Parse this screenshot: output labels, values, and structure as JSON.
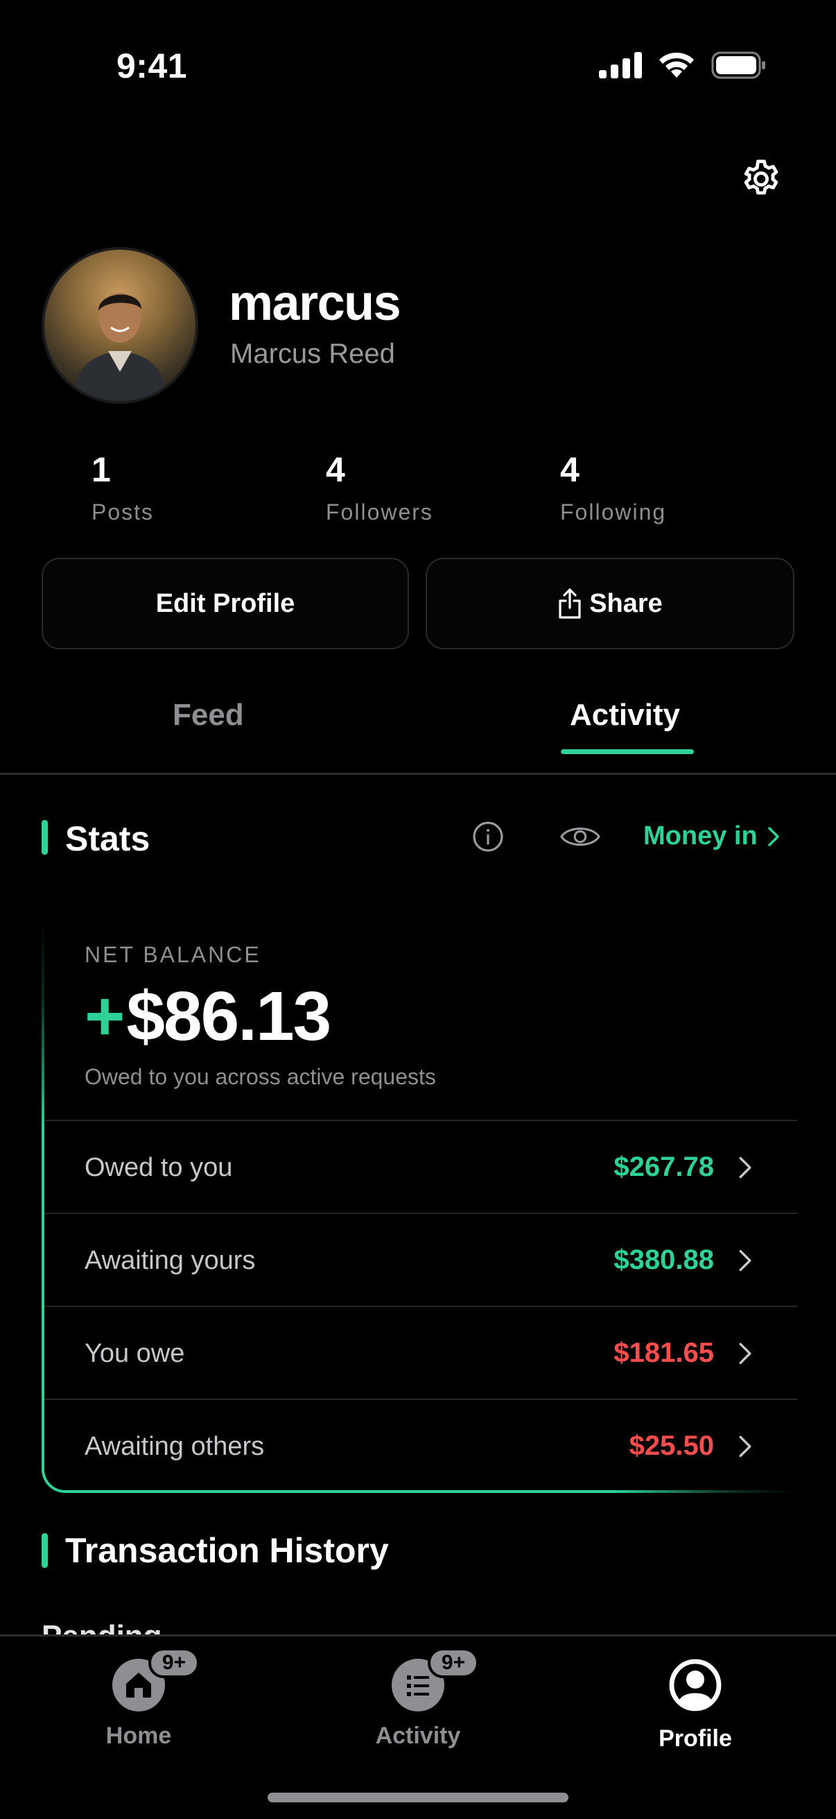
{
  "status_bar": {
    "time": "9:41"
  },
  "profile": {
    "username": "marcus",
    "full_name": "Marcus Reed",
    "stats": [
      {
        "value": "1",
        "label": "Posts"
      },
      {
        "value": "4",
        "label": "Followers"
      },
      {
        "value": "4",
        "label": "Following"
      }
    ],
    "edit_label": "Edit Profile",
    "share_label": "Share"
  },
  "tabs": [
    {
      "label": "Feed",
      "active": false
    },
    {
      "label": "Activity",
      "active": true
    }
  ],
  "stats_section": {
    "title": "Stats",
    "money_filter": "Money in",
    "net_balance": {
      "label": "NET BALANCE",
      "sign": "+",
      "amount": "$86.13",
      "subtitle": "Owed to you across active requests"
    },
    "rows": [
      {
        "label": "Owed to you",
        "value": "$267.78",
        "tone": "positive"
      },
      {
        "label": "Awaiting yours",
        "value": "$380.88",
        "tone": "positive"
      },
      {
        "label": "You owe",
        "value": "$181.65",
        "tone": "negative"
      },
      {
        "label": "Awaiting others",
        "value": "$25.50",
        "tone": "negative"
      }
    ]
  },
  "history_section": {
    "title": "Transaction History",
    "peek_text": "Pending"
  },
  "tab_bar": {
    "items": [
      {
        "label": "Home",
        "badge": "9+",
        "active": false
      },
      {
        "label": "Activity",
        "badge": "9+",
        "active": false
      },
      {
        "label": "Profile",
        "badge": "",
        "active": true
      }
    ]
  },
  "colors": {
    "accent": "#2ed196",
    "negative": "#ff4d4d",
    "muted": "#8e8e93",
    "background": "#000000"
  }
}
